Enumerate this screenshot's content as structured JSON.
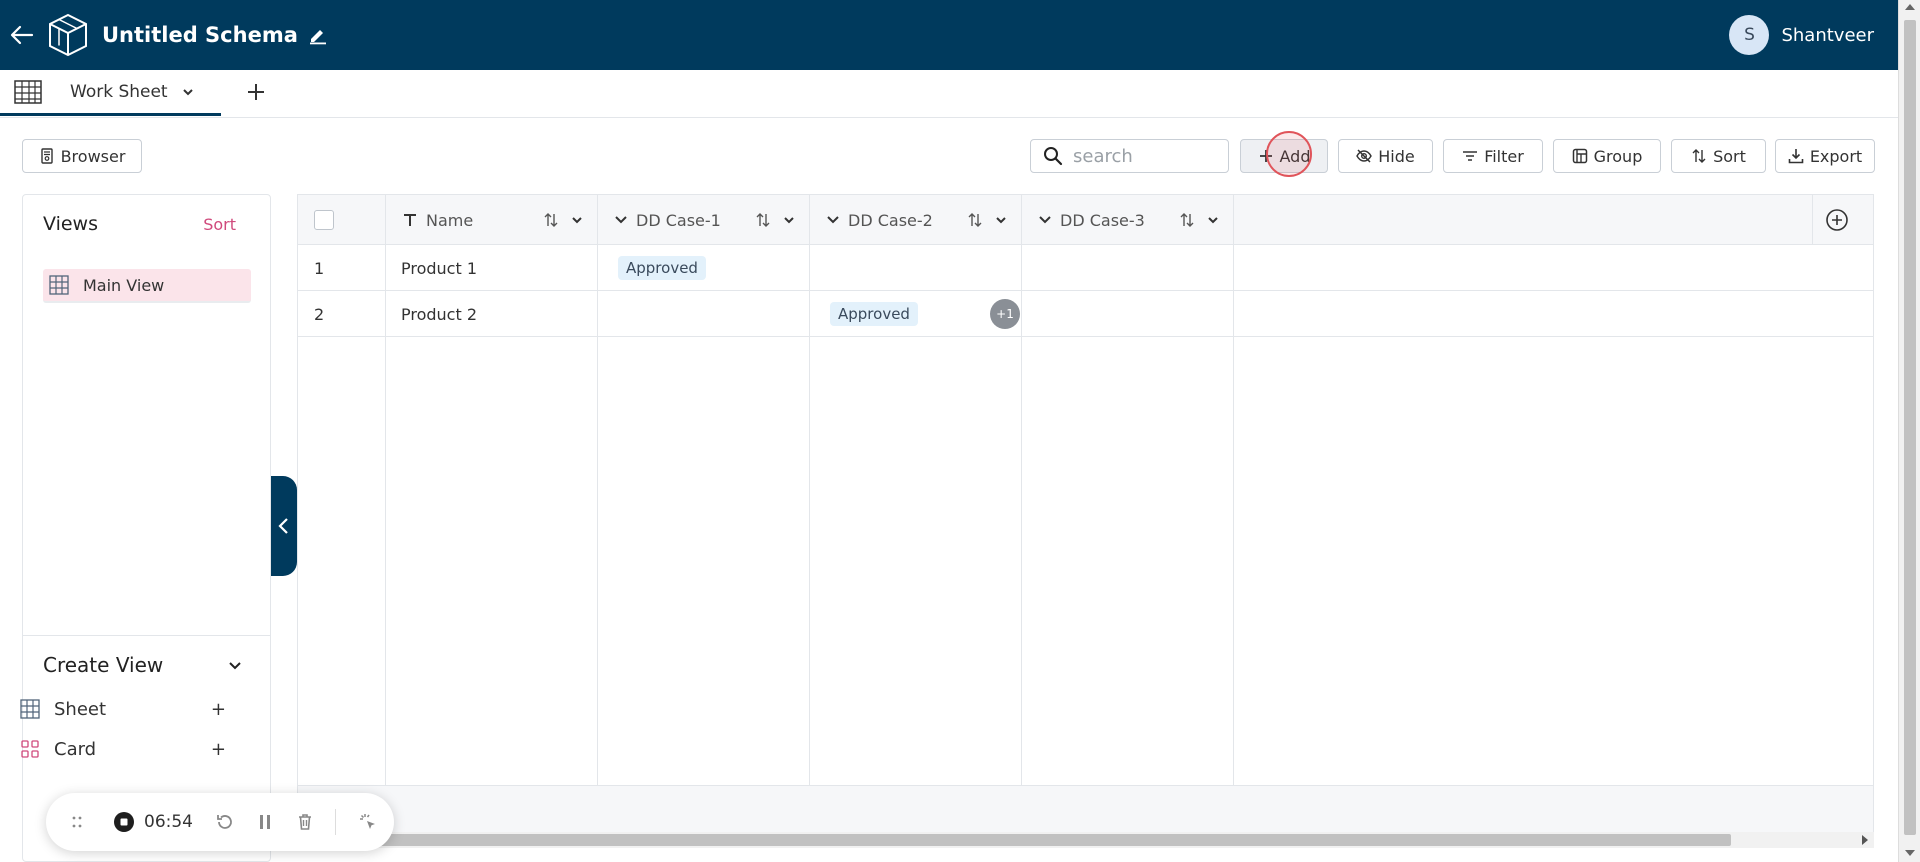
{
  "header": {
    "title": "Untitled Schema",
    "user_initial": "S",
    "user_name": "Shantveer"
  },
  "tabs": [
    {
      "label": "Work Sheet"
    }
  ],
  "toolbar": {
    "browser_label": "Browser",
    "search_placeholder": "search",
    "add_label": "Add",
    "hide_label": "Hide",
    "filter_label": "Filter",
    "group_label": "Group",
    "sort_label": "Sort",
    "export_label": "Export"
  },
  "sidebar": {
    "views_title": "Views",
    "sort_label": "Sort",
    "views": [
      {
        "label": "Main View"
      }
    ],
    "create_title": "Create View",
    "create_items": [
      {
        "label": "Sheet",
        "add": "+"
      },
      {
        "label": "Card",
        "add": "+"
      }
    ]
  },
  "grid": {
    "columns": [
      {
        "label": "Name"
      },
      {
        "label": "DD Case-1"
      },
      {
        "label": "DD Case-2"
      },
      {
        "label": "DD Case-3"
      }
    ],
    "rows": [
      {
        "index": "1",
        "name": "Product 1",
        "dd1": "Approved",
        "dd2": "",
        "dd2_more": "",
        "dd3": ""
      },
      {
        "index": "2",
        "name": "Product 2",
        "dd1": "",
        "dd2": "Approved",
        "dd2_more": "+1",
        "dd3": ""
      }
    ]
  },
  "recorder": {
    "time": "06:54"
  },
  "colors": {
    "header_bg": "#003a5d",
    "accent_pink": "#d04a7c",
    "badge_bg": "#e3f1fb"
  }
}
